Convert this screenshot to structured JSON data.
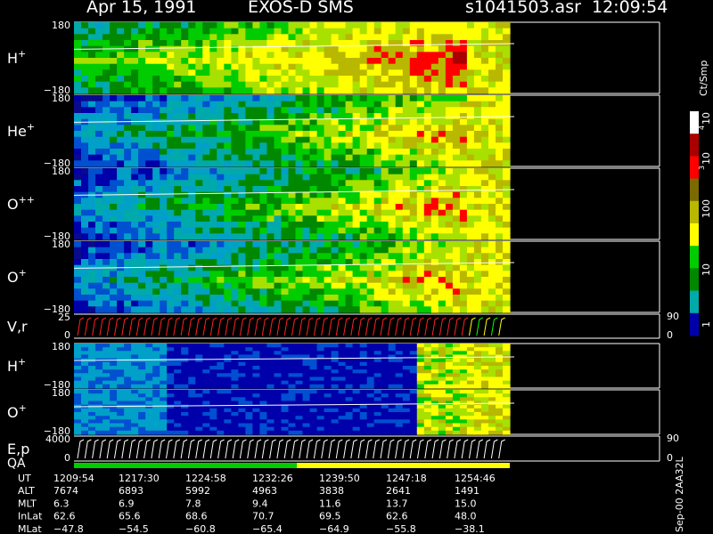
{
  "header": {
    "date": "Apr 15, 1991",
    "instrument": "EXOS-D SMS",
    "file_time": "s1041503.asr  12:09:54"
  },
  "panels": [
    {
      "id": "h-plus",
      "label": "H",
      "sup": "+",
      "ytop": "180",
      "ybot": "−180"
    },
    {
      "id": "he-plus",
      "label": "He",
      "sup": "+",
      "ytop": "180",
      "ybot": "−180"
    },
    {
      "id": "o-plusplus",
      "label": "O",
      "sup": "++",
      "ytop": "180",
      "ybot": "−180"
    },
    {
      "id": "o-plus",
      "label": "O",
      "sup": "+",
      "ytop": "180",
      "ybot": "−180"
    },
    {
      "id": "v-r",
      "label": "V,r",
      "sup": "",
      "ytop": "25",
      "ybot": "0",
      "rtop": "90",
      "rbot": "0"
    },
    {
      "id": "h-plus-2",
      "label": "H",
      "sup": "+",
      "ytop": "180",
      "ybot": "−180"
    },
    {
      "id": "o-plus-2",
      "label": "O",
      "sup": "+",
      "ytop": "180",
      "ybot": "−180"
    },
    {
      "id": "e-p",
      "label": "E,p",
      "sup": "",
      "ytop": "4000",
      "ybot": "0",
      "rtop": "90",
      "rbot": "0"
    }
  ],
  "qa_label": "QA",
  "colorbar": {
    "unit": "Ct/Smp",
    "ticks": [
      "10",
      "4",
      "10",
      "3",
      "100",
      "10",
      "1"
    ],
    "colors": [
      "#ffffff",
      "#aa0000",
      "#ff0000",
      "#7a6a00",
      "#b8b800",
      "#ffff00",
      "#00cc00",
      "#008800",
      "#00aaaa",
      "#0000aa"
    ]
  },
  "side_note": "Sep-00 2AA32L",
  "table": {
    "rows": [
      {
        "label": "UT",
        "values": [
          "1209:54",
          "1217:30",
          "1224:58",
          "1232:26",
          "1239:50",
          "1247:18",
          "1254:46"
        ]
      },
      {
        "label": "ALT",
        "values": [
          "7674",
          "6893",
          "5992",
          "4963",
          "3838",
          "2641",
          "1491"
        ]
      },
      {
        "label": "MLT",
        "values": [
          "6.3",
          "6.9",
          "7.8",
          "9.4",
          "11.6",
          "13.7",
          "15.0"
        ]
      },
      {
        "label": "InLat",
        "values": [
          "62.6",
          "65.6",
          "68.6",
          "70.7",
          "69.5",
          "62.6",
          "48.0"
        ]
      },
      {
        "label": "MLat",
        "values": [
          "−47.8",
          "−54.5",
          "−60.8",
          "−65.4",
          "−64.9",
          "−55.8",
          "−38.1"
        ]
      }
    ]
  }
}
